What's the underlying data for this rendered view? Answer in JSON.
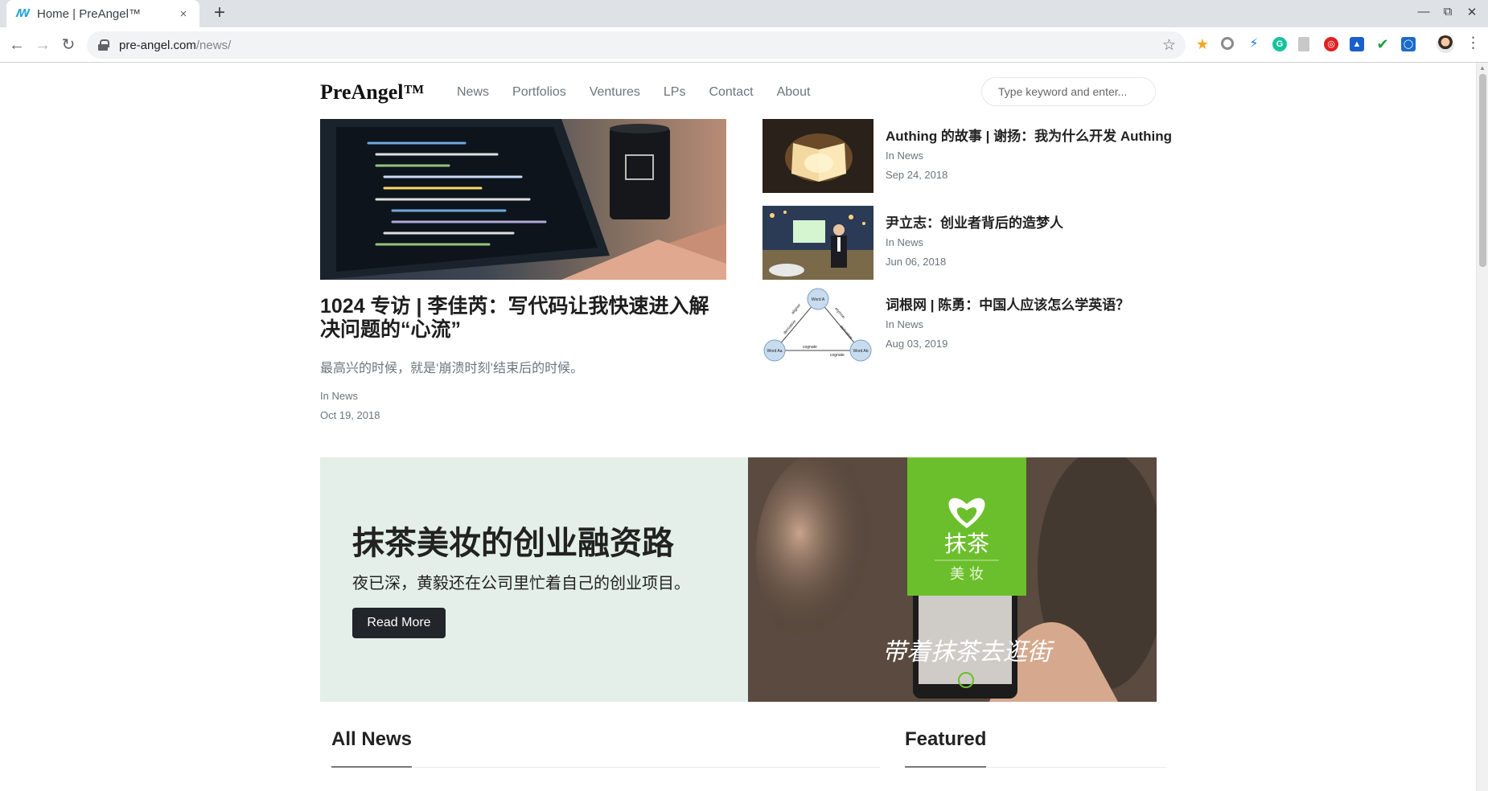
{
  "browser": {
    "tab_title": "Home | PreAngel™",
    "url_host": "pre-angel.com",
    "url_path": "/news/",
    "new_tab": "+",
    "close_tab": "×"
  },
  "site": {
    "logo": "PreAngel™",
    "nav": [
      "News",
      "Portfolios",
      "Ventures",
      "LPs",
      "Contact",
      "About"
    ],
    "search_placeholder": "Type keyword and enter..."
  },
  "featured": {
    "title": "1024 专访 | 李佳芮：写代码让我快速进入解决问题的“心流”",
    "excerpt": "最高兴的时候，就是‘崩溃时刻’结束后的时候。",
    "category": "In News",
    "date": "Oct 19, 2018"
  },
  "side_posts": [
    {
      "title": "Authing 的故事 | 谢扬：我为什么开发 Authing",
      "category": "In News",
      "date": "Sep 24, 2018"
    },
    {
      "title": "尹立志：创业者背后的造梦人",
      "category": "In News",
      "date": "Jun 06, 2018"
    },
    {
      "title": "词根网 | 陈勇：中国人应该怎么学英语？",
      "category": "In News",
      "date": "Aug 03, 2019"
    }
  ],
  "diagram_labels": {
    "top": "Word A",
    "left": "Word Aa",
    "right": "Word Ab",
    "edge_left_upper": "aligner",
    "edge_left_lower": "derivative",
    "edge_right_upper": "etymon",
    "edge_right_lower": "derivative",
    "edge_bottom_upper": "cognate",
    "edge_bottom_lower": "cognate"
  },
  "banner": {
    "title": "抹茶美妆的创业融资路",
    "text": "夜已深，黄毅还在公司里忙着自己的创业项目。",
    "button": "Read More",
    "image_brand_top": "抹茶",
    "image_brand_bottom": "美 妆",
    "image_slogan": "带着抹茶去逛街"
  },
  "sections": {
    "all_news": "All News",
    "featured": "Featured"
  },
  "colors": {
    "banner_bg": "#e4efe9",
    "button_bg": "#222529",
    "brand_green": "#6cbf2c"
  }
}
